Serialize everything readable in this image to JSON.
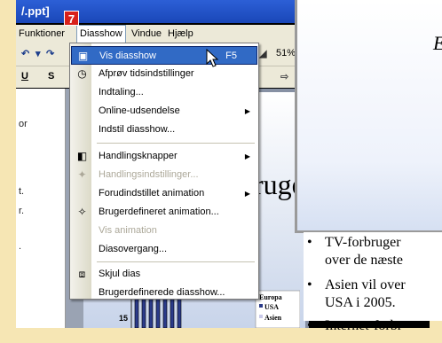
{
  "window": {
    "title": "/.ppt]"
  },
  "step_badge": "7",
  "menubar": {
    "items": [
      "Funktioner",
      "Diasshow",
      "Vindue",
      "Hjælp"
    ]
  },
  "toolbar": {
    "zoom": "51%",
    "bold": "U",
    "shadow": "S"
  },
  "left_pane": {
    "fragments": [
      "or",
      "t.",
      "r.",
      "."
    ]
  },
  "slide": {
    "title_fragment": "ruge",
    "chart": {
      "y_tick": "15",
      "legend": [
        "Europa",
        "USA",
        "Asien"
      ]
    }
  },
  "menu": {
    "items": [
      {
        "label": "Vis diasshow",
        "shortcut": "F5",
        "icon": "slideshow-icon",
        "state": "highlighted"
      },
      {
        "label": "Afprøv tidsindstillinger",
        "icon": "timer-icon",
        "state": "enabled"
      },
      {
        "label": "Indtaling...",
        "state": "enabled"
      },
      {
        "label": "Online-udsendelse",
        "submenu": true,
        "state": "enabled"
      },
      {
        "label": "Indstil diasshow...",
        "state": "enabled"
      },
      {
        "label": "Handlingsknapper",
        "submenu": true,
        "icon": "action-buttons-icon",
        "state": "enabled"
      },
      {
        "label": "Handlingsindstillinger...",
        "icon": "action-settings-icon",
        "state": "disabled"
      },
      {
        "label": "Forudindstillet animation",
        "submenu": true,
        "state": "enabled"
      },
      {
        "label": "Brugerdefineret animation...",
        "icon": "custom-animation-icon",
        "state": "enabled"
      },
      {
        "label": "Vis animation",
        "state": "disabled"
      },
      {
        "label": "Diasovergang...",
        "state": "enabled"
      },
      {
        "label": "Skjul dias",
        "icon": "hide-slide-icon",
        "state": "enabled"
      },
      {
        "label": "Brugerdefinerede diasshow...",
        "state": "enabled"
      }
    ]
  },
  "slideshow_view": {
    "letter": "E",
    "bullets": [
      {
        "line1": "TV-forbruger",
        "line2": "over de næste"
      },
      {
        "line1": "Asien vil over",
        "line2": "USA i 2005."
      },
      {
        "line1": "Internet-forbr",
        "line2": ""
      }
    ]
  },
  "colors": {
    "highlight": "#316ac5",
    "titlebar": "#1a47b8",
    "badge": "#d8211b"
  }
}
